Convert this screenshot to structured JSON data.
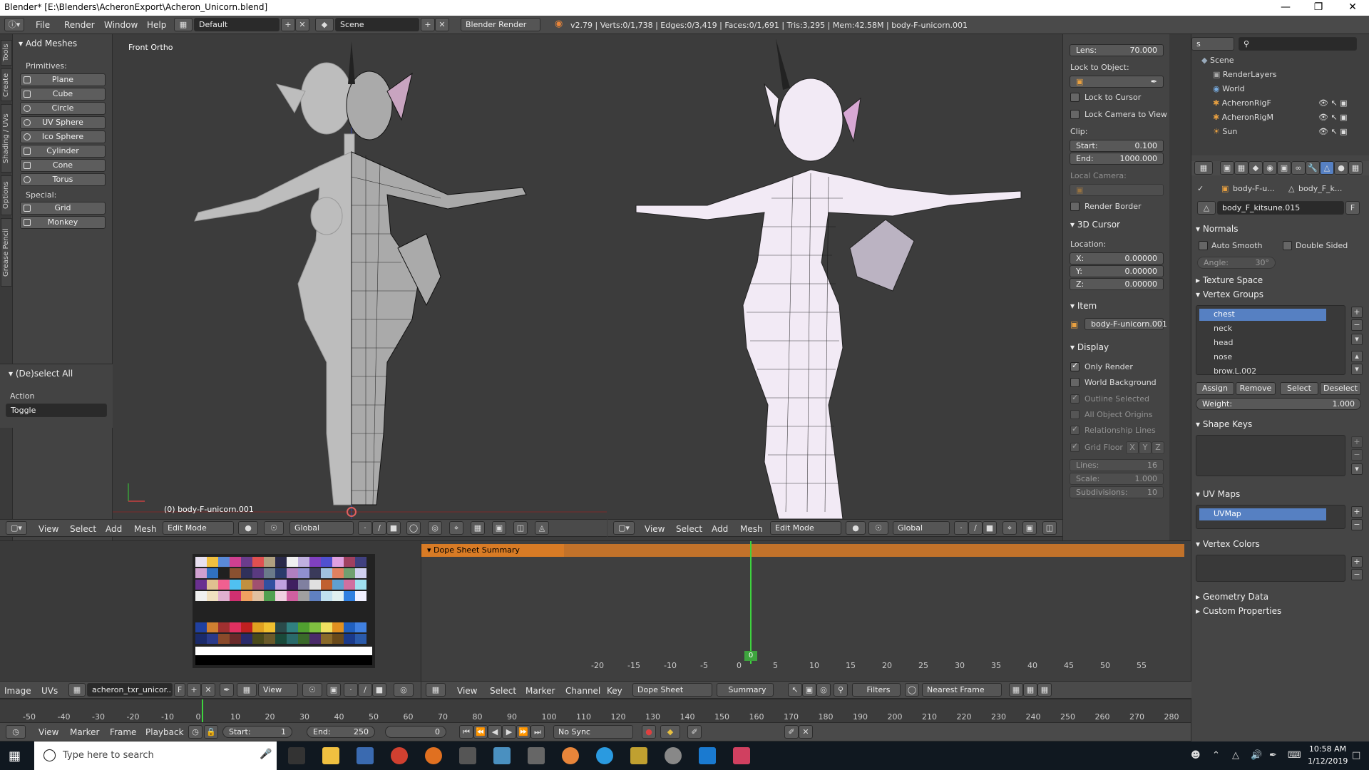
{
  "window": {
    "title": "Blender* [E:\\Blenders\\AcheronExport\\Acheron_Unicorn.blend]"
  },
  "menu": {
    "file": "File",
    "render": "Render",
    "window": "Window",
    "help": "Help"
  },
  "info": {
    "layout": "Default",
    "scene": "Scene",
    "engine": "Blender Render",
    "stats": "v2.79 | Verts:0/1,738 | Edges:0/3,419 | Faces:0/1,691 | Tris:3,295 | Mem:42.58M | body-F-unicorn.001"
  },
  "vtabs": [
    "Tools",
    "Create",
    "Shading / UVs",
    "Options",
    "Grease Pencil"
  ],
  "toolshelf": {
    "add_meshes": "Add Meshes",
    "primitives": "Primitives:",
    "prim_items": [
      "Plane",
      "Cube",
      "Circle",
      "UV Sphere",
      "Ico Sphere",
      "Cylinder",
      "Cone",
      "Torus"
    ],
    "special": "Special:",
    "special_items": [
      "Grid",
      "Monkey"
    ],
    "operator": "(De)select All",
    "action_label": "Action",
    "action_value": "Toggle"
  },
  "viewport_left": {
    "view_label": "Front Ortho",
    "object_label": "(0) body-F-unicorn.001"
  },
  "vheader": {
    "view": "View",
    "select": "Select",
    "add": "Add",
    "mesh": "Mesh",
    "mode": "Edit Mode",
    "orientation": "Global"
  },
  "npanel": {
    "lens_k": "Lens:",
    "lens_v": "70.000",
    "lock_obj": "Lock to Object:",
    "lock_cursor": "Lock to Cursor",
    "lock_cam": "Lock Camera to View",
    "clip": "Clip:",
    "start_k": "Start:",
    "start_v": "0.100",
    "end_k": "End:",
    "end_v": "1000.000",
    "local_cam": "Local Camera:",
    "render_border": "Render Border",
    "cursor_h": "3D Cursor",
    "location": "Location:",
    "x_k": "X:",
    "x_v": "0.00000",
    "y_k": "Y:",
    "y_v": "0.00000",
    "z_k": "Z:",
    "z_v": "0.00000",
    "item_h": "Item",
    "item_name": "body-F-unicorn.001",
    "display_h": "Display",
    "only_render": "Only Render",
    "world_bg": "World Background",
    "outline_sel": "Outline Selected",
    "all_origins": "All Object Origins",
    "rel_lines": "Relationship Lines",
    "grid_floor": "Grid Floor",
    "gx": "X",
    "gy": "Y",
    "gz": "Z",
    "lines_k": "Lines:",
    "lines_v": "16",
    "scale_k": "Scale:",
    "scale_v": "1.000",
    "subdiv_k": "Subdivisions:",
    "subdiv_v": "10"
  },
  "outliner": {
    "items": [
      {
        "label": "Scene",
        "indent": 0
      },
      {
        "label": "RenderLayers",
        "indent": 1
      },
      {
        "label": "World",
        "indent": 1
      },
      {
        "label": "AcheronRigF",
        "indent": 1
      },
      {
        "label": "AcheronRigM",
        "indent": 1
      },
      {
        "label": "Sun",
        "indent": 1
      }
    ],
    "view_dd": "s"
  },
  "props": {
    "bc1": "body-F-u...",
    "bc2": "body_F_k...",
    "mesh_name": "body_F_kitsune.015",
    "fake_user": "F",
    "normals": "Normals",
    "auto_smooth": "Auto Smooth",
    "double_sided": "Double Sided",
    "angle_k": "Angle:",
    "angle_v": "30°",
    "texture_space": "Texture Space",
    "vertex_groups": "Vertex Groups",
    "vgroups": [
      "chest",
      "neck",
      "head",
      "nose",
      "brow.L.002"
    ],
    "assign": "Assign",
    "remove": "Remove",
    "select": "Select",
    "deselect": "Deselect",
    "weight_k": "Weight:",
    "weight_v": "1.000",
    "shape_keys": "Shape Keys",
    "uv_maps": "UV Maps",
    "uvmap": "UVMap",
    "vertex_colors": "Vertex Colors",
    "geometry_data": "Geometry Data",
    "custom_props": "Custom Properties"
  },
  "image_editor": {
    "image": "Image",
    "uvs": "UVs",
    "image_name": "acheron_txr_unicor...",
    "f": "F",
    "view": "View"
  },
  "dope": {
    "summary": "Dope Sheet Summary",
    "ticks": [
      "-20",
      "-15",
      "-10",
      "-5",
      "0",
      "5",
      "10",
      "15",
      "20",
      "25",
      "30",
      "35",
      "40",
      "45",
      "50",
      "55"
    ],
    "current_frame": "0",
    "view": "View",
    "select": "Select",
    "marker": "Marker",
    "channel": "Channel",
    "key": "Key",
    "mode": "Dope Sheet",
    "summary_btn": "Summary",
    "filters": "Filters",
    "snap": "Nearest Frame"
  },
  "timeline": {
    "ticks": [
      "-50",
      "-40",
      "-30",
      "-20",
      "-10",
      "0",
      "10",
      "20",
      "30",
      "40",
      "50",
      "60",
      "70",
      "80",
      "90",
      "100",
      "110",
      "120",
      "130",
      "140",
      "150",
      "160",
      "170",
      "180",
      "190",
      "200",
      "210",
      "220",
      "230",
      "240",
      "250",
      "260",
      "270",
      "280"
    ],
    "view": "View",
    "marker": "Marker",
    "frame": "Frame",
    "playback": "Playback",
    "start_k": "Start:",
    "start_v": "1",
    "end_k": "End:",
    "end_v": "250",
    "current": "0",
    "sync": "No Sync"
  },
  "taskbar": {
    "search": "Type here to search",
    "time": "10:58 AM",
    "date": "1/12/2019"
  },
  "colors": {
    "selected": "#5680c2",
    "dope_summary": "#d87b25",
    "playhead": "#3ed33e",
    "taskbar": "#101820"
  }
}
